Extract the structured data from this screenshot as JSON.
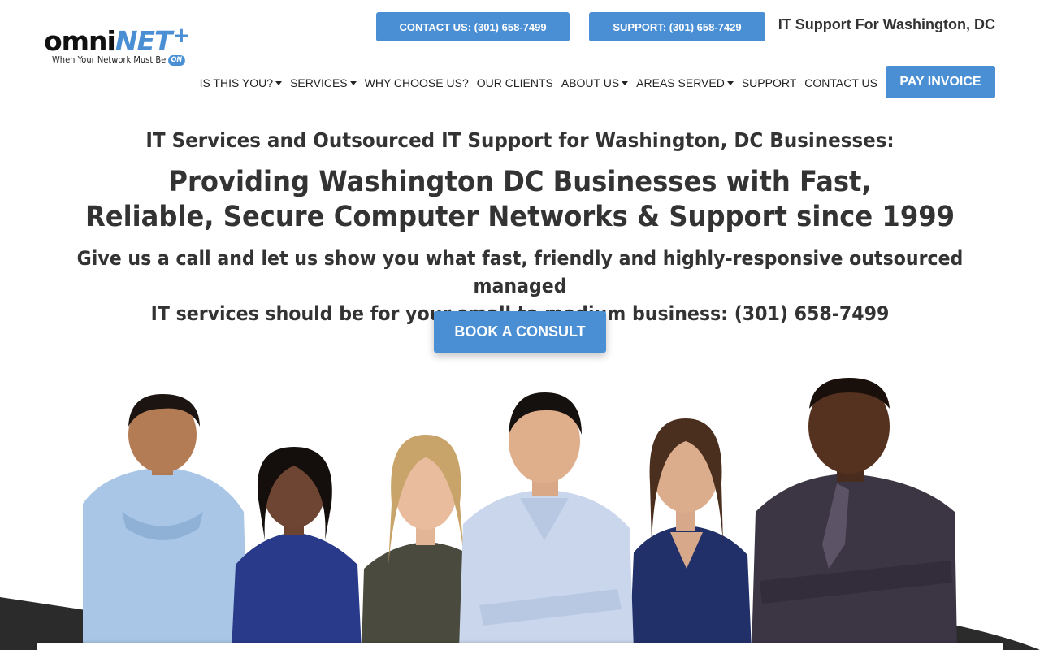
{
  "logo": {
    "omni": "omni",
    "net": "NET",
    "plus": "+",
    "tagline": "When Your Network Must Be",
    "badge": "ON"
  },
  "header": {
    "contact_button": "CONTACT US: (301) 658-7499",
    "support_button": "SUPPORT: (301) 658-7429",
    "tagline": "IT Support For Washington, DC",
    "pay_invoice": "PAY INVOICE"
  },
  "nav": {
    "items": [
      {
        "label": "IS THIS YOU?",
        "dropdown": true
      },
      {
        "label": "SERVICES",
        "dropdown": true
      },
      {
        "label": "WHY CHOOSE US?",
        "dropdown": false
      },
      {
        "label": "OUR CLIENTS",
        "dropdown": false
      },
      {
        "label": "ABOUT US",
        "dropdown": true
      },
      {
        "label": "AREAS SERVED",
        "dropdown": true
      },
      {
        "label": "SUPPORT",
        "dropdown": false
      },
      {
        "label": "CONTACT US",
        "dropdown": false
      }
    ]
  },
  "hero": {
    "subheading": "IT Services and Outsourced IT Support for Washington, DC Businesses:",
    "title_line1": "Providing Washington DC Businesses with Fast,",
    "title_line2": "Reliable, Secure Computer Networks & Support since 1999",
    "text_line1": "Give us a call and let us show you what fast, friendly and highly-responsive outsourced managed",
    "text_line2": "IT services should be for your small to medium business: (301) 658-7499",
    "cta": "BOOK A CONSULT"
  },
  "colors": {
    "accent": "#4a8fd4",
    "text": "#333333",
    "background": "#ffffff"
  }
}
